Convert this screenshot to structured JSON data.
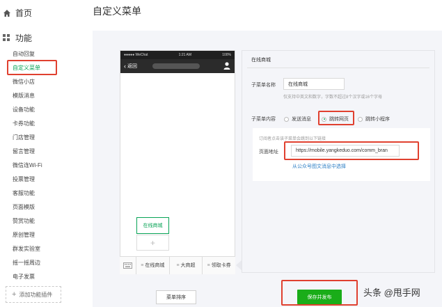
{
  "sidebar": {
    "home": {
      "label": "首页",
      "icon": "home-icon"
    },
    "section": {
      "label": "功能",
      "icon": "grid-icon"
    },
    "items": [
      {
        "label": "自动回复"
      },
      {
        "label": "自定义菜单",
        "active": true
      },
      {
        "label": "微信小店"
      },
      {
        "label": "模版消息"
      },
      {
        "label": "设备功能"
      },
      {
        "label": "卡券功能"
      },
      {
        "label": "门店管理"
      },
      {
        "label": "留言管理"
      },
      {
        "label": "微信连Wi-Fi"
      },
      {
        "label": "投票管理"
      },
      {
        "label": "客服功能"
      },
      {
        "label": "页面模版"
      },
      {
        "label": "赞赏功能"
      },
      {
        "label": "原创管理"
      },
      {
        "label": "群发实验室"
      },
      {
        "label": "摇一摇周边"
      },
      {
        "label": "电子发票"
      }
    ],
    "add_plugin": "添加功能插件"
  },
  "page_title": "自定义菜单",
  "phone": {
    "status_left": "●●●●● WeChat",
    "status_time": "1:21 AM",
    "status_right": "100%",
    "back_label": "返回",
    "sub_menu_item": "在线商城",
    "bottom_menus": [
      "在线商城",
      "大商超",
      "领取卡券"
    ]
  },
  "editor": {
    "header": "在线商城",
    "name_label": "子菜单名称",
    "name_value": "在线商城",
    "name_hint": "仅支持中英文和数字，字数不超过8个汉字或16个字母",
    "content_label": "子菜单内容",
    "options": [
      {
        "label": "发送消息",
        "selected": false
      },
      {
        "label": "跳转网页",
        "selected": true
      },
      {
        "label": "跳转小程序",
        "selected": false
      }
    ],
    "link_hint": "订阅者点击该子菜单会跳到以下链接",
    "url_label": "页面地址",
    "url_value": "https://mobile.yangkeduo.com/comm_bran",
    "pick_link": "从公众号图文消息中选择"
  },
  "buttons": {
    "sort": "菜单排序",
    "save": "保存并发布"
  },
  "watermark": "头条 @甩手网",
  "colors": {
    "accent_green": "#1aad19",
    "highlight_red": "#e0402f",
    "panel_bg": "#f4f5f9"
  }
}
